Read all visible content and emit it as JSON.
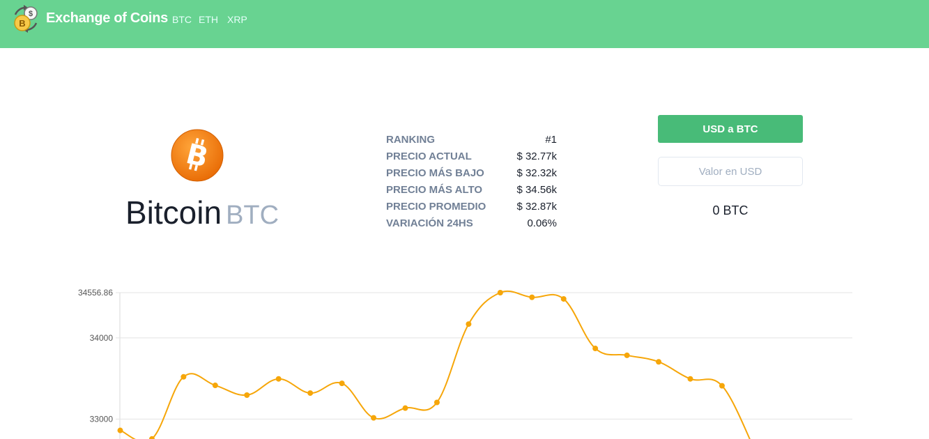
{
  "header": {
    "brand": "Exchange of Coins",
    "logo_icon": "coins-exchange-icon",
    "nav": [
      "BTC",
      "ETH",
      "XRP"
    ],
    "bg_color": "#68d391"
  },
  "coin": {
    "name": "Bitcoin",
    "symbol": "BTC",
    "icon": "bitcoin-icon"
  },
  "stats": [
    {
      "label": "RANKING",
      "value": "#1"
    },
    {
      "label": "PRECIO ACTUAL",
      "value": "$ 32.77k"
    },
    {
      "label": "PRECIO MÁS BAJO",
      "value": "$ 32.32k"
    },
    {
      "label": "PRECIO MÁS ALTO",
      "value": "$ 34.56k"
    },
    {
      "label": "PRECIO PROMEDIO",
      "value": "$ 32.87k"
    },
    {
      "label": "VARIACIÓN 24HS",
      "value": "0.06%"
    }
  ],
  "converter": {
    "button_label": "USD a BTC",
    "input_placeholder": "Valor en USD",
    "input_value": "",
    "result": "0 BTC",
    "button_color": "#48bb78"
  },
  "chart_data": {
    "type": "line",
    "y_ticks": [
      "34556.86",
      "34000",
      "33000"
    ],
    "ylim": [
      32850,
      34556.86
    ],
    "grid": true,
    "line_color": "#f6a609",
    "values": [
      32860,
      32755,
      33520,
      33415,
      33295,
      33495,
      33320,
      33440,
      33015,
      33135,
      33205,
      34170,
      34556.86,
      34500,
      34480,
      33870,
      33785,
      33705,
      33495,
      33410,
      32650
    ]
  }
}
